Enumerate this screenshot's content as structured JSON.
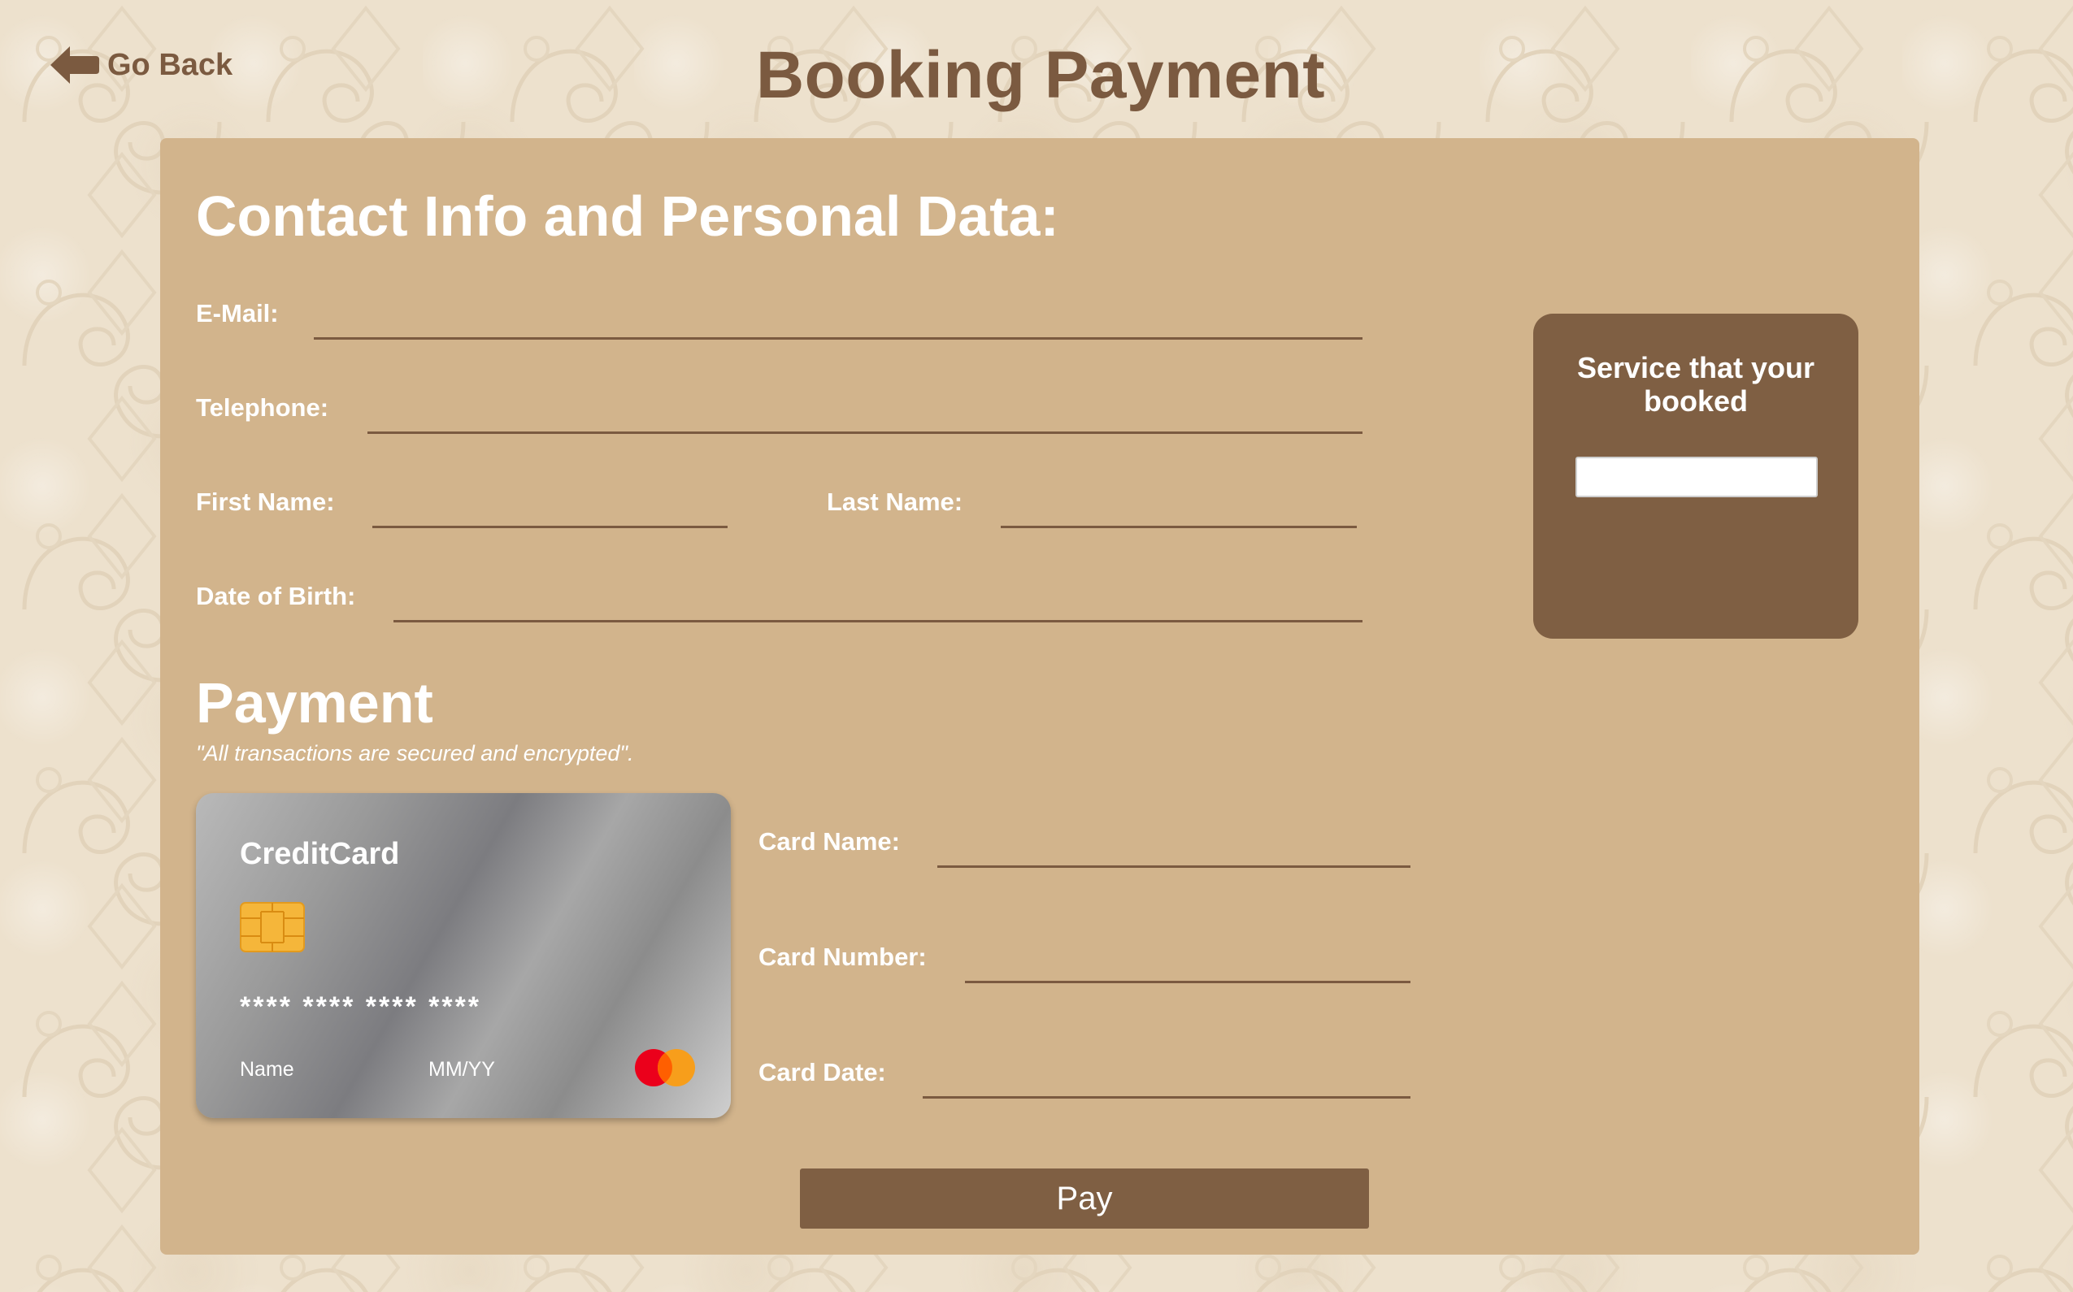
{
  "header": {
    "back_label": "Go Back",
    "title": "Booking Payment"
  },
  "contact": {
    "heading": "Contact Info and Personal Data:",
    "email_label": "E-Mail:",
    "email_value": "",
    "telephone_label": "Telephone:",
    "telephone_value": "",
    "first_name_label": "First Name:",
    "first_name_value": "",
    "last_name_label": "Last Name:",
    "last_name_value": "",
    "dob_label": "Date of Birth:",
    "dob_value": ""
  },
  "service": {
    "heading": "Service that your booked",
    "value": ""
  },
  "payment": {
    "heading": "Payment",
    "note": "\"All transactions are secured and encrypted\".",
    "card_name_label": "Card Name:",
    "card_name_value": "",
    "card_number_label": "Card Number:",
    "card_number_value": "",
    "card_date_label": "Card Date:",
    "card_date_value": "",
    "pay_label": "Pay"
  },
  "card": {
    "brand": "CreditCard",
    "number_mask": "**** **** **** ****",
    "name_placeholder": "Name",
    "expiry_placeholder": "MM/YY",
    "logo_icon": "mastercard-logo-icon",
    "chip_icon": "card-chip-icon"
  },
  "colors": {
    "accent_brown": "#7f5f43",
    "panel_tan": "#d2b48c",
    "background_cream": "#ede1cd",
    "text_white": "#ffffff"
  }
}
